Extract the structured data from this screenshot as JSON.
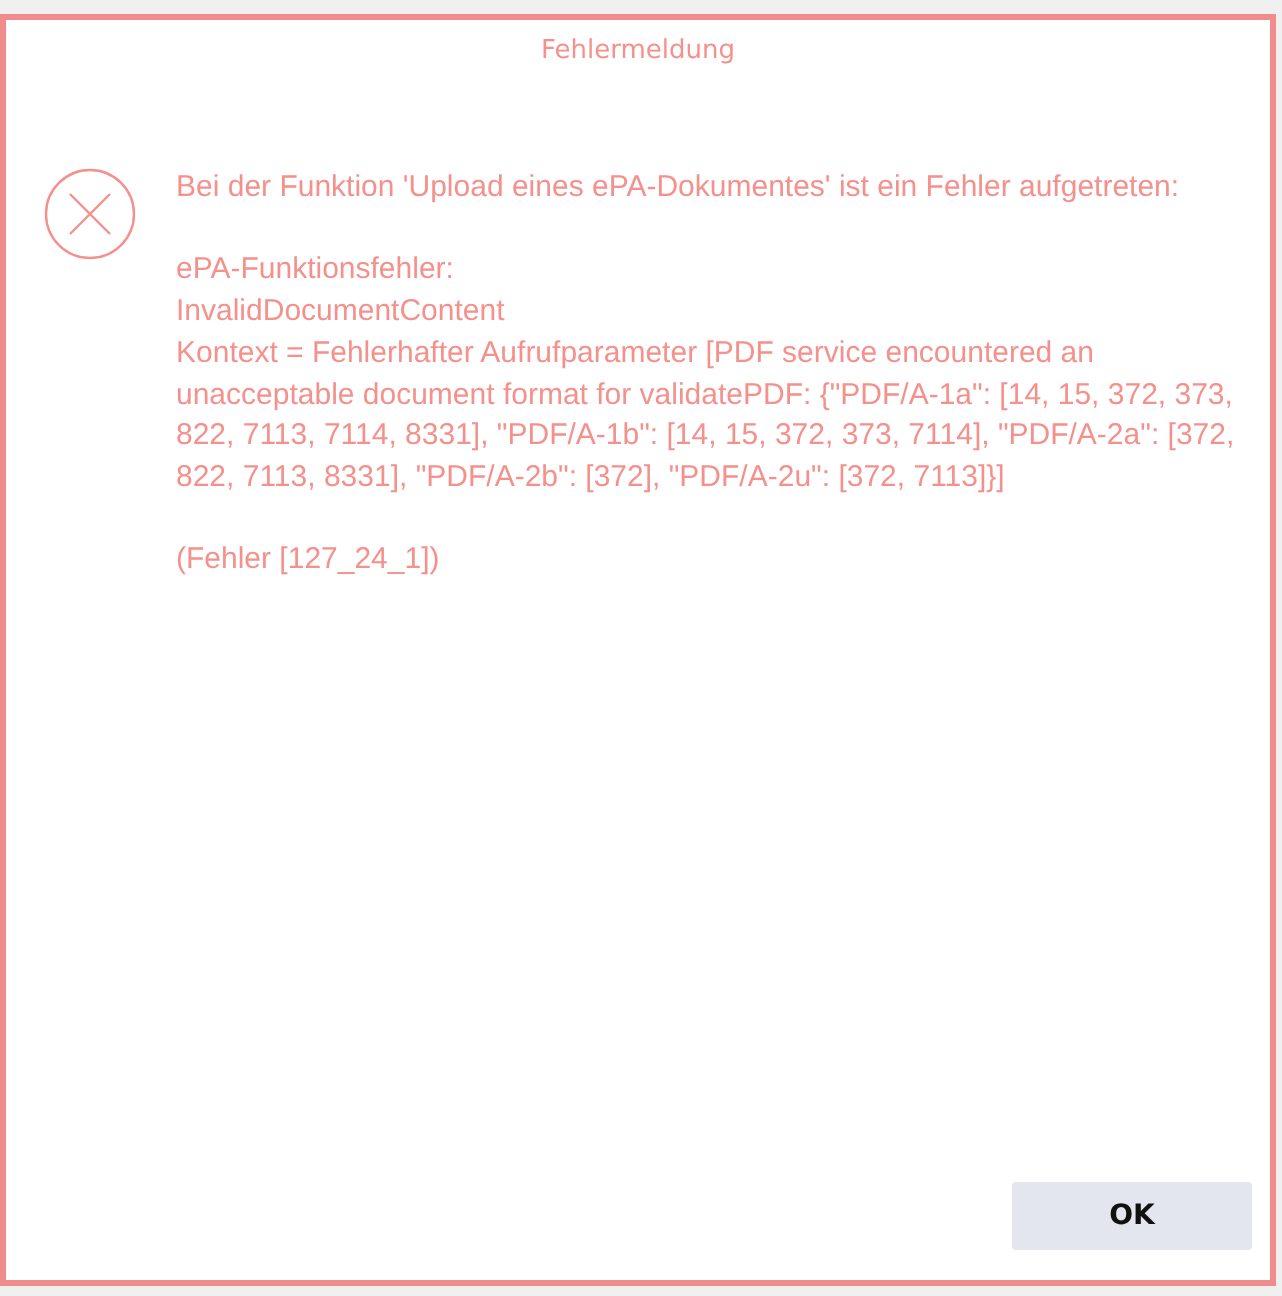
{
  "dialog": {
    "title": "Fehlermeldung",
    "paragraphs": [
      [
        "Bei der Funktion 'Upload eines ePA-Dokumentes' ist ein Fehler aufgetreten:"
      ],
      [
        "ePA-Funktionsfehler:",
        "InvalidDocumentContent",
        "Kontext = Fehlerhafter Aufrufparameter [PDF service encountered an unacceptable document format for validatePDF: {\"PDF/A-1a\": [14, 15, 372, 373, 822, 7113, 7114, 8331], \"PDF/A-1b\": [14, 15, 372, 373, 7114], \"PDF/A-2a\": [372, 822, 7113, 8331], \"PDF/A-2b\": [372], \"PDF/A-2u\": [372, 7113]}]"
      ],
      [
        "(Fehler [127_24_1])"
      ]
    ],
    "buttons": [
      "OK"
    ]
  }
}
